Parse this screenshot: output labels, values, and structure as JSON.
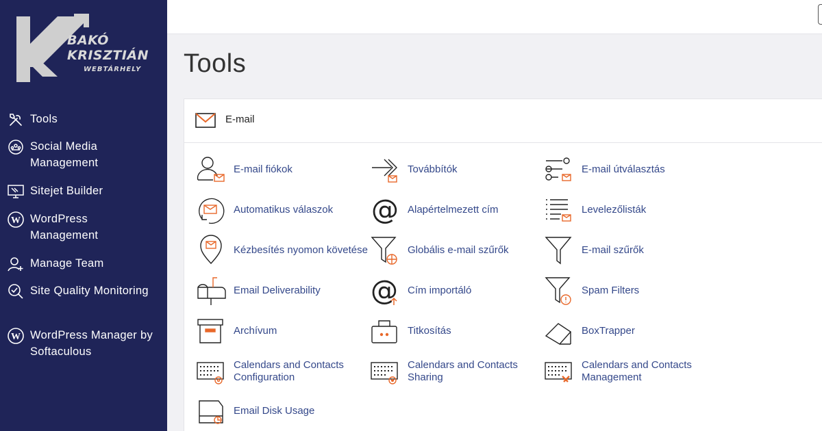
{
  "brand": {
    "line1": "BAKÓ",
    "line2": "KRISZTIÁN",
    "line3": "WEBTÁRHELY"
  },
  "sidebar": {
    "items": [
      {
        "label": "Tools",
        "icon": "tools-icon"
      },
      {
        "label": "Social Media Management",
        "icon": "social-media-icon"
      },
      {
        "label": "Sitejet Builder",
        "icon": "sitejet-icon"
      },
      {
        "label": "WordPress Management",
        "icon": "wordpress-icon"
      },
      {
        "label": "Manage Team",
        "icon": "team-icon"
      },
      {
        "label": "Site Quality Monitoring",
        "icon": "quality-icon"
      },
      {
        "label": "WordPress Manager by Softaculous",
        "icon": "wordpress-icon"
      }
    ]
  },
  "page": {
    "title": "Tools"
  },
  "email_section": {
    "title": "E-mail",
    "tools": [
      {
        "label": "E-mail fiókok",
        "icon": "email-accounts-icon"
      },
      {
        "label": "Továbbítók",
        "icon": "forwarders-icon"
      },
      {
        "label": "E-mail útválasztás",
        "icon": "email-routing-icon"
      },
      {
        "label": "Automatikus válaszok",
        "icon": "autoresponders-icon"
      },
      {
        "label": "Alapértelmezett cím",
        "icon": "default-address-icon"
      },
      {
        "label": "Levelezőlisták",
        "icon": "mailing-lists-icon"
      },
      {
        "label": "Kézbesítés nyomon követése",
        "icon": "track-delivery-icon"
      },
      {
        "label": "Globális e-mail szűrők",
        "icon": "global-filters-icon"
      },
      {
        "label": "E-mail szűrők",
        "icon": "email-filters-icon"
      },
      {
        "label": "Email Deliverability",
        "icon": "deliverability-icon"
      },
      {
        "label": "Cím importáló",
        "icon": "address-importer-icon"
      },
      {
        "label": "Spam Filters",
        "icon": "spam-filters-icon"
      },
      {
        "label": "Archívum",
        "icon": "archive-icon"
      },
      {
        "label": "Titkosítás",
        "icon": "encryption-icon"
      },
      {
        "label": "BoxTrapper",
        "icon": "boxtrapper-icon"
      },
      {
        "label": "Calendars and Contacts Configuration",
        "icon": "calendars-config-icon"
      },
      {
        "label": "Calendars and Contacts Sharing",
        "icon": "calendars-sharing-icon"
      },
      {
        "label": "Calendars and Contacts Management",
        "icon": "calendars-management-icon"
      },
      {
        "label": "Email Disk Usage",
        "icon": "disk-usage-icon"
      }
    ]
  },
  "colors": {
    "sidebar_bg": "#1f2458",
    "accent_orange": "#e8682a",
    "link_blue": "#34488a"
  }
}
